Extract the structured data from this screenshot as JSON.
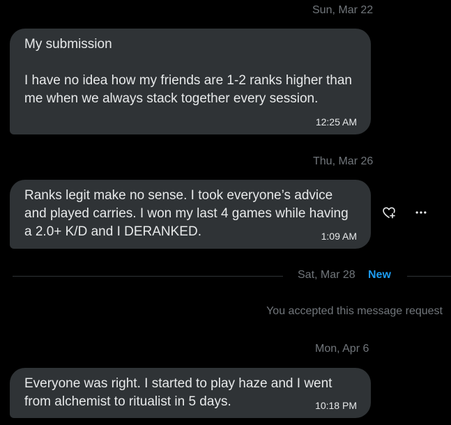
{
  "colors": {
    "background": "#000000",
    "bubble": "#2f3336",
    "text": "#e7e9ea",
    "muted": "#71767b",
    "accent": "#1d9bf0"
  },
  "conversation": {
    "messages": [
      {
        "date": "Sun, Mar 22",
        "text": "My submission\n\nI have no idea how my friends are 1-2 ranks higher than me when we always stack together every session.",
        "time": "12:25 AM"
      },
      {
        "date": "Thu, Mar 26",
        "text": "Ranks legit make no sense. I took everyone’s advice and played carries. I won my last 4 games while having a 2.0+ K/D and I DERANKED.",
        "time": "1:09 AM"
      },
      {
        "date": "Mon, Apr 6",
        "text": "Everyone was right. I started to play haze and I went from alchemist to ritualist in 5 days.",
        "time": "10:18 PM"
      }
    ],
    "divider": {
      "date": "Sat, Mar 28",
      "new_label": "New"
    },
    "system_note": "You accepted this message request"
  },
  "actions": {
    "react_icon": "heart-plus-icon",
    "more_icon": "more-horizontal-icon"
  }
}
